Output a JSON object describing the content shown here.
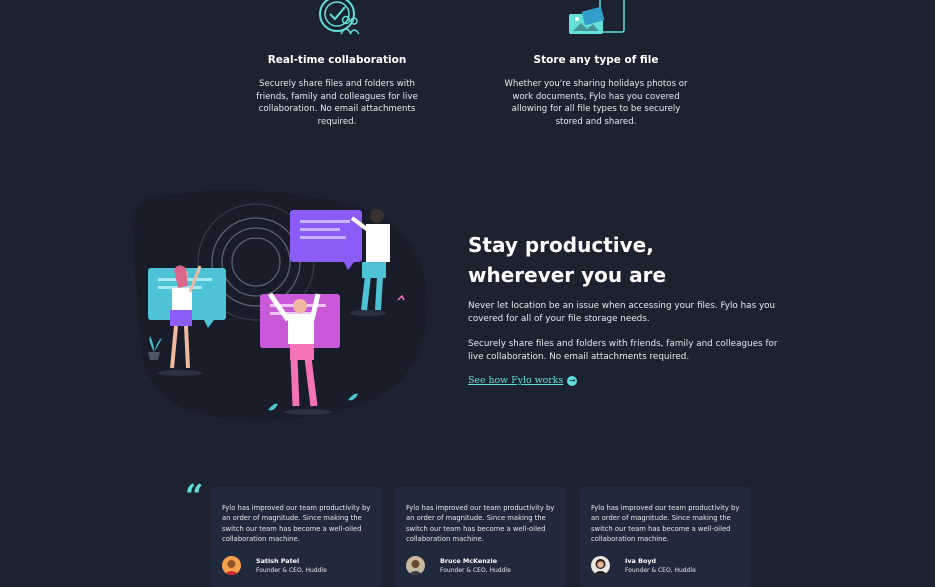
{
  "features": [
    {
      "title": "Real-time collaboration",
      "text": "Securely share files and folders with friends, family and colleagues for live collaboration. No email attachments required.",
      "icon": "collaboration-icon"
    },
    {
      "title": "Store any type of file",
      "text": "Whether you're sharing holidays photos or work documents, Fylo has you covered allowing for all file types to be securely stored and shared.",
      "icon": "file-types-icon"
    }
  ],
  "productive": {
    "title_line1": "Stay productive,",
    "title_line2": "wherever you are",
    "paragraph1": "Never let location be an issue when accessing your files. Fylo has you covered for all of your file storage needs.",
    "paragraph2": "Securely share files and folders with friends, family and colleagues for live collaboration. No email attachments required.",
    "link_text": "See how Fylo works",
    "link_icon": "arrow-circle-icon",
    "illustration": "people-with-chat-bubbles-illustration"
  },
  "testimonials": [
    {
      "quote": "Fylo has improved our team productivity by an order of magnitude. Since making the switch our team has become a well-oiled collaboration machine.",
      "name": "Satish Patel",
      "role": "Founder & CEO, Huddle"
    },
    {
      "quote": "Fylo has improved our team productivity by an order of magnitude. Since making the switch our team has become a well-oiled collaboration machine.",
      "name": "Bruce McKenzie",
      "role": "Founder & CEO, Huddle"
    },
    {
      "quote": "Fylo has improved our team productivity by an order of magnitude. Since making the switch our team has become a well-oiled collaboration machine.",
      "name": "Iva Boyd",
      "role": "Founder & CEO, Huddle"
    }
  ],
  "quote_mark": "“",
  "colors": {
    "background": "#1c2230",
    "card_background": "#21293c",
    "accent_cyan": "#62e0d9",
    "accent_blue": "#339ecc",
    "text": "#ffffff"
  }
}
